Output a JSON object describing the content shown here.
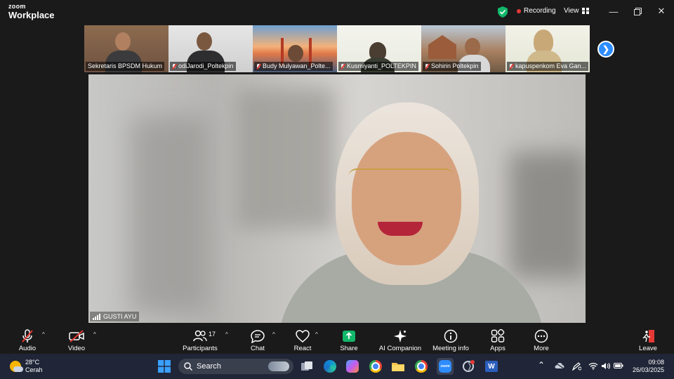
{
  "app": {
    "brand_top": "zoom",
    "brand_bottom": "Workplace"
  },
  "titlebar": {
    "recording_label": "Recording",
    "view_label": "View"
  },
  "participants_strip": [
    {
      "name": "Sekretaris BPSDM Hukum",
      "muted": false
    },
    {
      "name": "odiJarodi_Poltekpin",
      "muted": true
    },
    {
      "name": "Budy Mulyawan_Polte...",
      "muted": true
    },
    {
      "name": "Kusmiyanti_POLTEKPIN",
      "muted": true
    },
    {
      "name": "Sohirin Poltekpin",
      "muted": true
    },
    {
      "name": "kapuspenkom Eva Gan...",
      "muted": true
    }
  ],
  "main_video": {
    "speaker_name": "GUSTI AYU"
  },
  "toolbar": {
    "audio": "Audio",
    "video": "Video",
    "participants": "Participants",
    "participants_count": "17",
    "chat": "Chat",
    "react": "React",
    "share": "Share",
    "ai_companion": "AI Companion",
    "meeting_info": "Meeting info",
    "apps": "Apps",
    "more": "More",
    "leave": "Leave"
  },
  "taskbar": {
    "weather_temp": "28°C",
    "weather_desc": "Cerah",
    "search_placeholder": "Search",
    "time": "09:08",
    "date": "26/03/2025"
  },
  "colors": {
    "zoom_blue": "#2d8cff",
    "share_green": "#12b76a",
    "leave_red": "#e53935"
  }
}
